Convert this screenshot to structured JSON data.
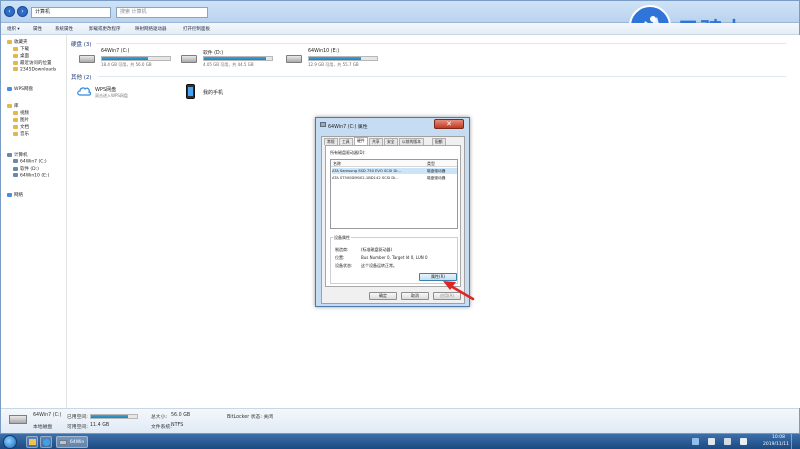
{
  "explorer": {
    "address": "计算机",
    "search_placeholder": "搜索 计算机",
    "toolbar": [
      "组织 ▾",
      "属性",
      "系统属性",
      "卸载或更改程序",
      "映射网络驱动器",
      "打开控制面板"
    ],
    "sidebar": {
      "favorites_label": "收藏夹",
      "favorites": [
        "下载",
        "桌面",
        "最近访问的位置",
        "2345Downloads"
      ],
      "wps_label": "WPS网盘",
      "libraries_label": "库",
      "libraries": [
        "视频",
        "图片",
        "文档",
        "音乐"
      ],
      "computer_label": "计算机",
      "drives": [
        "64Win7 (C:)",
        "软件 (D:)",
        "64Win10 (E:)"
      ],
      "network_label": "网络"
    },
    "sections": {
      "hdd_label": "硬盘 (3)",
      "other_label": "其他 (2)"
    },
    "drives": [
      {
        "name": "64Win7 (C:)",
        "free": "18.4 GB 可用，共 56.0 GB",
        "used": 0.67
      },
      {
        "name": "软件 (D:)",
        "free": "4.05 GB 可用，共 44.5 GB",
        "used": 0.91
      },
      {
        "name": "64Win10 (E:)",
        "free": "12.9 GB 可用，共 55.7 GB",
        "used": 0.77
      }
    ],
    "others": [
      {
        "name": "WPS网盘",
        "desc": "双击进入WPS网盘"
      },
      {
        "name": "我的手机",
        "desc": ""
      }
    ],
    "details": {
      "drive_name": "64Win7 (C:)",
      "used_label": "已用空间:",
      "local_disk": "本地磁盘",
      "free_label": "可用空间:",
      "free_value": "11.4 GB",
      "total_label": "总大小:",
      "total_value": "56.0 GB",
      "fs_label": "文件系统:",
      "fs_value": "NTFS",
      "bitlocker": "BitLocker 状态: 关闭",
      "used_fraction": 0.8
    }
  },
  "dialog": {
    "title": "64Win7 (C:) 属性",
    "close_glyph": "✕",
    "tabs": [
      "常规",
      "工具",
      "硬件",
      "共享",
      "安全",
      "以前的版本",
      "配额"
    ],
    "active_tab": "硬件",
    "all_drives_label": "所有磁盘驱动器(D):",
    "col_name": "名称",
    "col_type": "类型",
    "rows": [
      {
        "name": "ATA Samsung SSD 750 EVO SCSI Di...",
        "type": "磁盘驱动器"
      },
      {
        "name": "ATA ST500DM002-1BD142 SCSI Di...",
        "type": "磁盘驱动器"
      }
    ],
    "device_props_label": "设备属性",
    "props": [
      {
        "k": "制造商:",
        "v": "(标准磁盘驱动器)"
      },
      {
        "k": "位置:",
        "v": "Bus Number 0, Target Id 0, LUN 0"
      },
      {
        "k": "设备状态:",
        "v": "这个设备运转正常。"
      }
    ],
    "properties_button": "属性(R)",
    "ok": "确定",
    "cancel": "取消",
    "apply": "应用(A)"
  },
  "brand": {
    "text": "云骑士",
    "color": "#2f74d8"
  },
  "taskbar": {
    "task_label": "64Win",
    "time": "10:08",
    "date": "2019/11/11"
  }
}
